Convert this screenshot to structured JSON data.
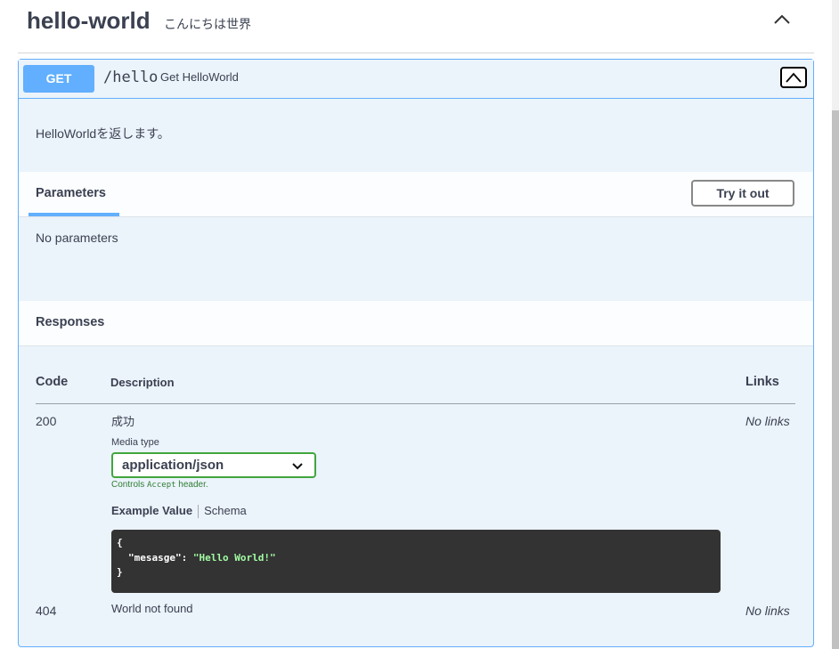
{
  "tag": {
    "title": "hello-world",
    "description": "こんにちは世界"
  },
  "operation": {
    "method": "GET",
    "path": "/hello",
    "summary": "Get HelloWorld",
    "description": "HelloWorldを返します。"
  },
  "parameters": {
    "title": "Parameters",
    "try_button": "Try it out",
    "empty_text": "No parameters"
  },
  "responses": {
    "title": "Responses",
    "headers": {
      "code": "Code",
      "description": "Description",
      "links": "Links"
    },
    "rows": [
      {
        "code": "200",
        "description": "成功",
        "links": "No links",
        "media_type_label": "Media type",
        "media_type": "application/json",
        "controls_note": {
          "prefix": "Controls ",
          "mono": "Accept",
          "suffix": " header."
        },
        "example_tab": "Example Value",
        "schema_tab": "Schema",
        "example": {
          "open": "{",
          "key": "\"mesasge\"",
          "colon": ": ",
          "value": "\"Hello World!\"",
          "close": "}"
        }
      },
      {
        "code": "404",
        "description": "World not found",
        "links": "No links"
      }
    ]
  },
  "colors": {
    "get_method": "#61affe",
    "accent_green": "#41a63e",
    "code_bg": "#333333"
  },
  "icons": {
    "tag_toggle": "chevron-up-icon",
    "collapse": "chevron-up-icon",
    "media_select": "chevron-down-icon"
  }
}
